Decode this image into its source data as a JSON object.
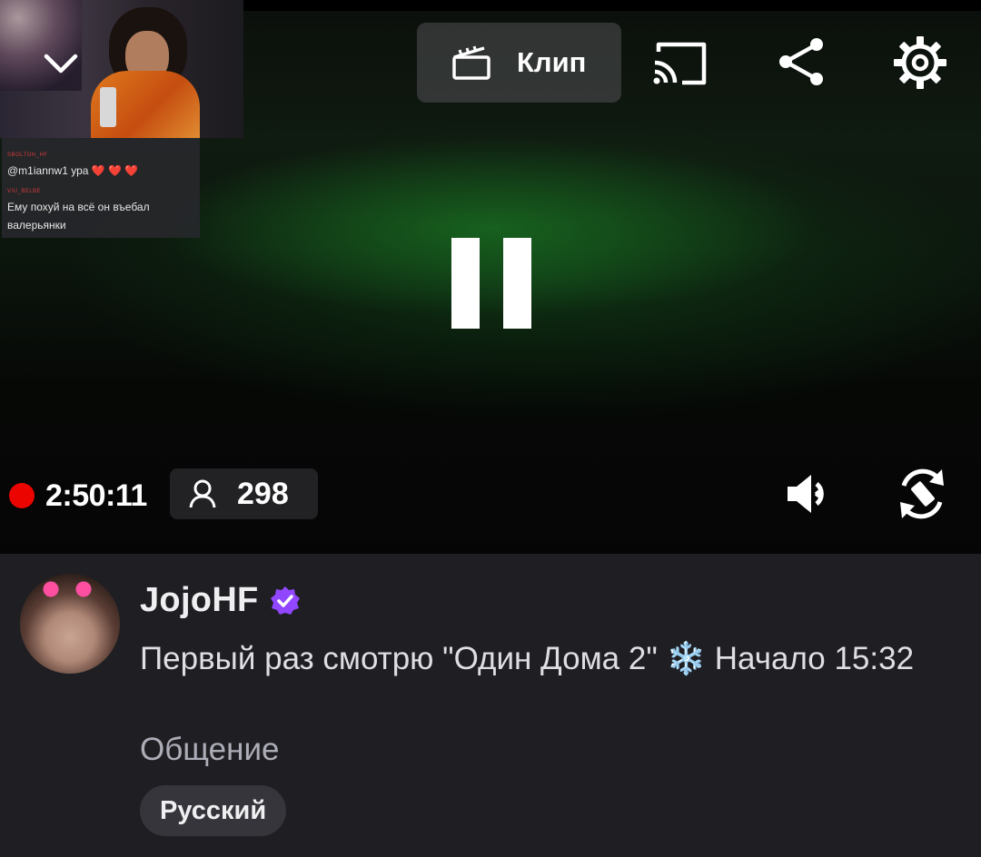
{
  "player": {
    "chat_overlay": {
      "messages": [
        {
          "user": "SBOLTON_HF",
          "text": "@m1iannw1 ура ❤️ ❤️ ❤️"
        },
        {
          "user": "VIU_BELBE",
          "text": "Ему похуй на всё он въебал валерьянки"
        }
      ]
    },
    "clip_label": "Клип",
    "live_time": "2:50:11",
    "viewer_count": "298",
    "icons": {
      "collapse": "chevron-down-icon",
      "clip": "clapperboard-icon",
      "cast": "cast-icon",
      "share": "share-icon",
      "settings": "gear-icon",
      "pause": "pause-icon",
      "live": "live-dot-icon",
      "viewers": "person-icon",
      "volume": "volume-icon",
      "rotate": "rotate-icon"
    }
  },
  "stream_info": {
    "streamer_name": "JojoHF",
    "verified": true,
    "title": "Первый раз смотрю \"Один Дома 2\" ❄️ Начало 15:32",
    "category": "Общение",
    "tags": [
      "Русский"
    ]
  },
  "colors": {
    "live_red": "#eb0400",
    "verified_purple": "#9147ff",
    "info_bg": "#1f1f23",
    "tag_bg": "#35353b"
  }
}
